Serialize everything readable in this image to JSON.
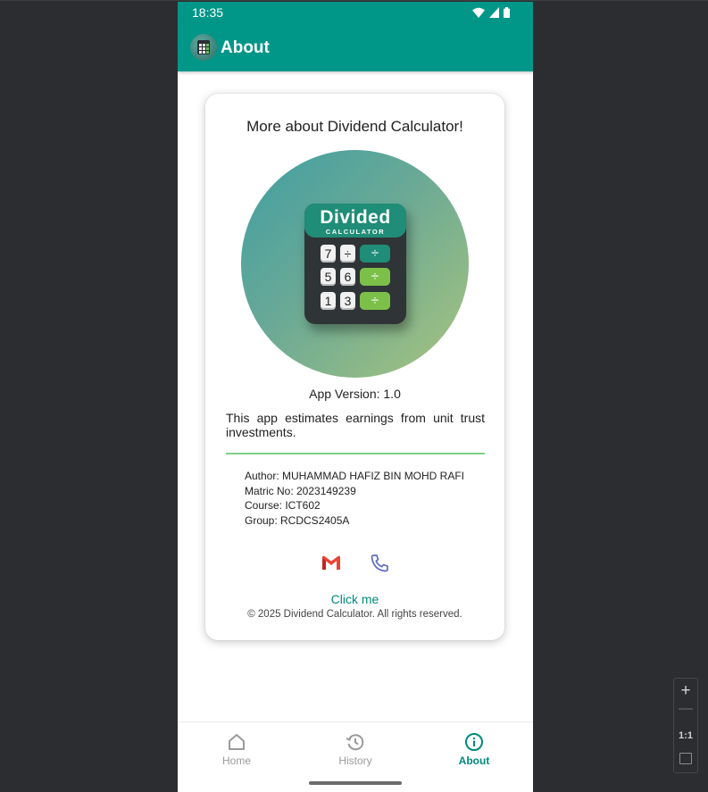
{
  "status_bar": {
    "time": "18:35"
  },
  "app_bar": {
    "title": "About"
  },
  "card": {
    "title": "More about Dividend Calculator!",
    "logo": {
      "title_line1": "Divided",
      "title_line2": "CALCULATOR",
      "keys": [
        "7",
        "÷",
        "5",
        "6",
        "1",
        "3"
      ],
      "operator": "÷"
    },
    "version": "App Version: 1.0",
    "description": "This app estimates earnings from unit trust investments.",
    "author": "Author: MUHAMMAD HAFIZ BIN MOHD RAFI",
    "matric": "Matric No: 2023149239",
    "course": "Course: ICT602",
    "group": "Group: RCDCS2405A",
    "click_me": "Click me",
    "copyright": "© 2025 Dividend Calculator. All rights reserved."
  },
  "bottom_nav": {
    "items": [
      {
        "label": "Home",
        "icon": "home-icon",
        "active": false
      },
      {
        "label": "History",
        "icon": "history-icon",
        "active": false
      },
      {
        "label": "About",
        "icon": "info-icon",
        "active": true
      }
    ]
  },
  "zoom_controls": {
    "zoom_in": "+",
    "zoom_out": "—",
    "actual_size": "1:1"
  },
  "colors": {
    "primary": "#009688",
    "accent_text": "#00897b",
    "divider": "#7bd08a",
    "nav_inactive": "#9a9a9a"
  }
}
